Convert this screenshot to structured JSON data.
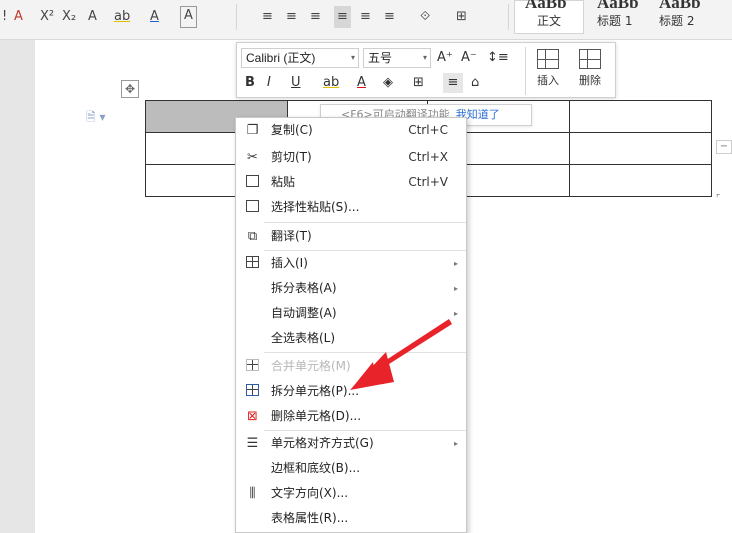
{
  "ribbon": {
    "text_tools": [
      "!",
      "A",
      "X²",
      "X₂",
      "A",
      "ab",
      "A",
      "A"
    ],
    "para_tools": [
      "≡",
      "≡",
      "≡",
      "≡",
      "≡",
      "≡",
      "⟐",
      "⊞"
    ],
    "styles": [
      {
        "preview": "AaBb",
        "label": "正文"
      },
      {
        "preview": "AaBb",
        "label": "标题 1"
      },
      {
        "preview": "AaBb",
        "label": "标题 2"
      }
    ]
  },
  "mini_toolbar": {
    "font_name": "Calibri (正文)",
    "font_size": "五号",
    "grow_font": "A⁺",
    "shrink_font": "A⁻",
    "line_spacing": "↕≡",
    "bold": "B",
    "italic": "I",
    "underline": "U",
    "highlight": "ab",
    "font_color": "A",
    "shading": "◈",
    "borders": "⊞",
    "align": "≡",
    "clear": "⌂",
    "insert_label": "插入",
    "delete_label": "删除"
  },
  "tooltip": {
    "text": "<F6>可启动翻译功能",
    "link": "我知道了"
  },
  "context_menu": {
    "items": [
      {
        "label": "复制(C)",
        "shortcut": "Ctrl+C",
        "icon": "copy-icon",
        "glyph": "❐"
      },
      {
        "label": "剪切(T)",
        "shortcut": "Ctrl+X",
        "icon": "scissors-icon",
        "glyph": "✂"
      },
      {
        "label": "粘贴",
        "shortcut": "Ctrl+V",
        "icon": "paste-icon",
        "glyph": "📋"
      },
      {
        "label": "选择性粘贴(S)...",
        "icon": "paste-special-icon",
        "glyph": "❔"
      },
      {
        "label": "翻译(T)",
        "icon": "translate-icon",
        "glyph": "⧉"
      },
      {
        "label": "插入(I)",
        "icon": "table-insert-icon"
      },
      {
        "label": "拆分表格(A)"
      },
      {
        "label": "自动调整(A)"
      },
      {
        "label": "全选表格(L)"
      },
      {
        "label": "合并单元格(M)",
        "icon": "merge-cells-icon",
        "disabled": true
      },
      {
        "label": "拆分单元格(P)...",
        "icon": "split-cells-icon"
      },
      {
        "label": "删除单元格(D)...",
        "icon": "delete-cells-icon",
        "glyph": "⊠"
      },
      {
        "label": "单元格对齐方式(G)",
        "icon": "cell-align-icon",
        "glyph": "☰"
      },
      {
        "label": "边框和底纹(B)..."
      },
      {
        "label": "文字方向(X)...",
        "icon": "text-direction-icon",
        "glyph": "⫼"
      },
      {
        "label": "表格属性(R)..."
      }
    ]
  },
  "colors": {
    "arrow": "#e8232a",
    "selected_cell": "#bcbcbc",
    "link": "#2a6fd6"
  }
}
